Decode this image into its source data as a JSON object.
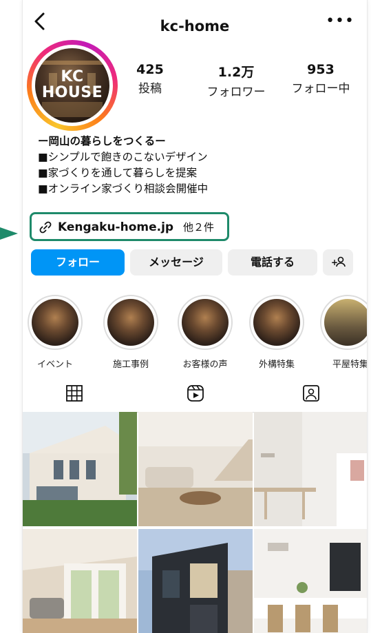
{
  "header": {
    "username": "kc-home"
  },
  "profile": {
    "avatar_text_line1": "KC",
    "avatar_text_line2": "HOUSE",
    "stats": [
      {
        "value": "425",
        "label": "投稿"
      },
      {
        "value": "1.2万",
        "label": "フォロワー"
      },
      {
        "value": "953",
        "label": "フォロー中"
      }
    ],
    "bio": [
      "ー岡山の暮らしをつくるー",
      "■シンプルで飽きのこないデザイン",
      "■家づくりを通して暮らしを提案",
      "■オンライン家づくり相談会開催中"
    ],
    "link": {
      "text": "Kengaku-home.jp",
      "extra": "他２件"
    }
  },
  "actions": {
    "follow": "フォロー",
    "message": "メッセージ",
    "call": "電話する",
    "add_user": "+"
  },
  "highlights": [
    {
      "label": "イベント"
    },
    {
      "label": "施工事例"
    },
    {
      "label": "お客様の声"
    },
    {
      "label": "外構特集"
    },
    {
      "label": "平屋特集"
    }
  ],
  "tabs": [
    "grid-icon",
    "reels-icon",
    "tagged-icon"
  ],
  "colors": {
    "follow_button": "#0095f6",
    "highlight_box": "#1e8a6a"
  }
}
